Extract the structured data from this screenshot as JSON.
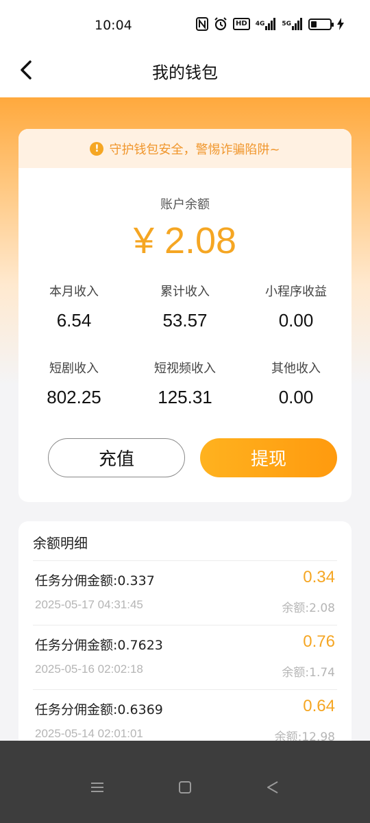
{
  "status_bar": {
    "time": "10:04",
    "icons": [
      "nfc-icon",
      "alarm-icon",
      "hd-icon",
      "signal-4g-icon",
      "signal-5g-icon",
      "battery-icon",
      "charging-icon"
    ],
    "hd_label": "HD",
    "net1": "4G",
    "net2": "5G"
  },
  "header": {
    "title": "我的钱包"
  },
  "wallet": {
    "notice": "守护钱包安全，警惕诈骗陷阱~",
    "balance_label": "账户余额",
    "balance": "¥ 2.08",
    "stats": [
      {
        "label": "本月收入",
        "value": "6.54"
      },
      {
        "label": "累计收入",
        "value": "53.57"
      },
      {
        "label": "小程序收益",
        "value": "0.00"
      },
      {
        "label": "短剧收入",
        "value": "802.25"
      },
      {
        "label": "短视频收入",
        "value": "125.31"
      },
      {
        "label": "其他收入",
        "value": "0.00"
      }
    ],
    "recharge_label": "充值",
    "withdraw_label": "提现"
  },
  "details": {
    "title": "余额明细",
    "items": [
      {
        "desc": "任务分佣金额:0.337",
        "amount": "0.34",
        "time": "2025-05-17 04:31:45",
        "balance": "余额:2.08"
      },
      {
        "desc": "任务分佣金额:0.7623",
        "amount": "0.76",
        "time": "2025-05-16 02:02:18",
        "balance": "余额:1.74"
      },
      {
        "desc": "任务分佣金额:0.6369",
        "amount": "0.64",
        "time": "2025-05-14 02:01:01",
        "balance": "余额:12.98"
      }
    ]
  },
  "colors": {
    "accent": "#f5a623",
    "header_gradient_top": "#ffa93d",
    "system_nav": "#3d3d3d"
  }
}
